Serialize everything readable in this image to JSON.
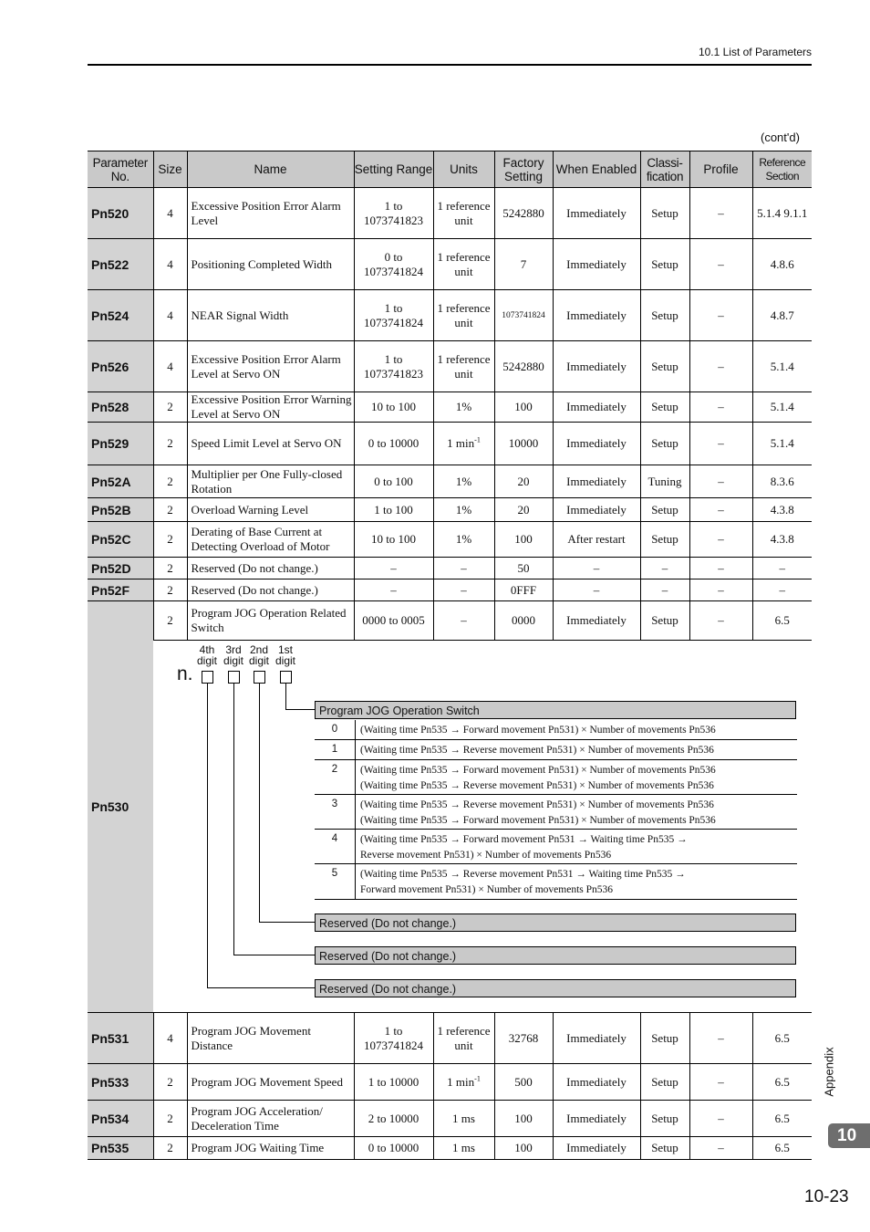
{
  "header": {
    "section": "10.1  List of Parameters",
    "contd": "(cont'd)"
  },
  "columns": [
    "Parameter No.",
    "Size",
    "Name",
    "Setting Range",
    "Units",
    "Factory Setting",
    "When Enabled",
    "Classi-fication",
    "Profile",
    "Reference Section"
  ],
  "rows_top": [
    {
      "no": "Pn520",
      "size": "4",
      "name": "Excessive Position Error Alarm Level",
      "range": "1 to 1073741823",
      "units": "1 reference unit",
      "factory": "5242880",
      "enabled": "Immediately",
      "class": "Setup",
      "profile": "–",
      "ref": "5.1.4 9.1.1"
    },
    {
      "no": "Pn522",
      "size": "4",
      "name": "Positioning Completed Width",
      "range": "0 to 1073741824",
      "units": "1 reference unit",
      "factory": "7",
      "enabled": "Immediately",
      "class": "Setup",
      "profile": "–",
      "ref": "4.8.6"
    },
    {
      "no": "Pn524",
      "size": "4",
      "name": "NEAR Signal Width",
      "range": "1 to 1073741824",
      "units": "1 reference unit",
      "factory": "1073741824",
      "enabled": "Immediately",
      "class": "Setup",
      "profile": "–",
      "ref": "4.8.7"
    },
    {
      "no": "Pn526",
      "size": "4",
      "name": "Excessive Position Error Alarm Level at Servo ON",
      "range": "1 to 1073741823",
      "units": "1 reference unit",
      "factory": "5242880",
      "enabled": "Immediately",
      "class": "Setup",
      "profile": "–",
      "ref": "5.1.4"
    },
    {
      "no": "Pn528",
      "size": "2",
      "name": "Excessive Position Error Warning Level at Servo ON",
      "range": "10 to 100",
      "units": "1%",
      "factory": "100",
      "enabled": "Immediately",
      "class": "Setup",
      "profile": "–",
      "ref": "5.1.4"
    },
    {
      "no": "Pn529",
      "size": "2",
      "name": "Speed Limit Level at Servo ON",
      "range": "0 to 10000",
      "units": "1 min-1",
      "factory": "10000",
      "enabled": "Immediately",
      "class": "Setup",
      "profile": "–",
      "ref": "5.1.4"
    },
    {
      "no": "Pn52A",
      "size": "2",
      "name": "Multiplier per One Fully-closed Rotation",
      "range": "0 to 100",
      "units": "1%",
      "factory": "20",
      "enabled": "Immediately",
      "class": "Tuning",
      "profile": "–",
      "ref": "8.3.6"
    },
    {
      "no": "Pn52B",
      "size": "2",
      "name": "Overload Warning Level",
      "range": "1 to 100",
      "units": "1%",
      "factory": "20",
      "enabled": "Immediately",
      "class": "Setup",
      "profile": "–",
      "ref": "4.3.8"
    },
    {
      "no": "Pn52C",
      "size": "2",
      "name": "Derating of Base Current at Detecting Overload of Motor",
      "range": "10 to 100",
      "units": "1%",
      "factory": "100",
      "enabled": "After restart",
      "class": "Setup",
      "profile": "–",
      "ref": "4.3.8"
    },
    {
      "no": "Pn52D",
      "size": "2",
      "name": "Reserved (Do not change.)",
      "range": "–",
      "units": "–",
      "factory": "50",
      "enabled": "–",
      "class": "–",
      "profile": "–",
      "ref": "–"
    },
    {
      "no": "Pn52F",
      "size": "2",
      "name": "Reserved (Do not change.)",
      "range": "–",
      "units": "–",
      "factory": "0FFF",
      "enabled": "–",
      "class": "–",
      "profile": "–",
      "ref": "–"
    }
  ],
  "pn530": {
    "no": "Pn530",
    "size": "2",
    "name": "Program JOG Operation Related Switch",
    "range": "0000 to 0005",
    "units": "–",
    "factory": "0000",
    "enabled": "Immediately",
    "class": "Setup",
    "profile": "–",
    "ref": "6.5",
    "prefix": "n.",
    "digits": [
      "4th digit",
      "3rd digit",
      "2nd digit",
      "1st digit"
    ],
    "switch_title": "Program JOG Operation Switch",
    "options": [
      {
        "value": "0",
        "lines": [
          "(Waiting time Pn535 → Forward movement Pn531) × Number of movements Pn536"
        ]
      },
      {
        "value": "1",
        "lines": [
          "(Waiting time Pn535 → Reverse movement Pn531) × Number of movements Pn536"
        ]
      },
      {
        "value": "2",
        "lines": [
          "(Waiting time Pn535 → Forward movement Pn531) × Number of movements Pn536",
          "(Waiting time Pn535 → Reverse movement Pn531) × Number of movements Pn536"
        ]
      },
      {
        "value": "3",
        "lines": [
          "(Waiting time Pn535 → Reverse movement Pn531) × Number of movements Pn536",
          "(Waiting time Pn535 → Forward movement Pn531) × Number of movements Pn536"
        ]
      },
      {
        "value": "4",
        "lines": [
          "(Waiting time Pn535 → Forward movement Pn531 → Waiting time Pn535 →",
          "Reverse movement Pn531) × Number of movements Pn536"
        ]
      },
      {
        "value": "5",
        "lines": [
          "(Waiting time Pn535 → Reverse movement Pn531 → Waiting time Pn535 →",
          "Forward movement Pn531) × Number of movements Pn536"
        ]
      }
    ],
    "reserved": [
      "Reserved (Do not change.)",
      "Reserved (Do not change.)",
      "Reserved (Do not change.)"
    ]
  },
  "rows_bottom": [
    {
      "no": "Pn531",
      "size": "4",
      "name": "Program JOG Movement Distance",
      "range": "1 to 1073741824",
      "units": "1 reference unit",
      "factory": "32768",
      "enabled": "Immediately",
      "class": "Setup",
      "profile": "–",
      "ref": "6.5"
    },
    {
      "no": "Pn533",
      "size": "2",
      "name": "Program JOG Movement Speed",
      "range": "1 to 10000",
      "units": "1 min-1",
      "factory": "500",
      "enabled": "Immediately",
      "class": "Setup",
      "profile": "–",
      "ref": "6.5"
    },
    {
      "no": "Pn534",
      "size": "2",
      "name": "Program JOG Acceleration/ Deceleration Time",
      "range": "2 to 10000",
      "units": "1 ms",
      "factory": "100",
      "enabled": "Immediately",
      "class": "Setup",
      "profile": "–",
      "ref": "6.5"
    },
    {
      "no": "Pn535",
      "size": "2",
      "name": "Program JOG Waiting Time",
      "range": "0 to 10000",
      "units": "1 ms",
      "factory": "100",
      "enabled": "Immediately",
      "class": "Setup",
      "profile": "–",
      "ref": "6.5"
    }
  ],
  "side": {
    "label": "Appendix",
    "chapter": "10",
    "page": "10-23"
  }
}
